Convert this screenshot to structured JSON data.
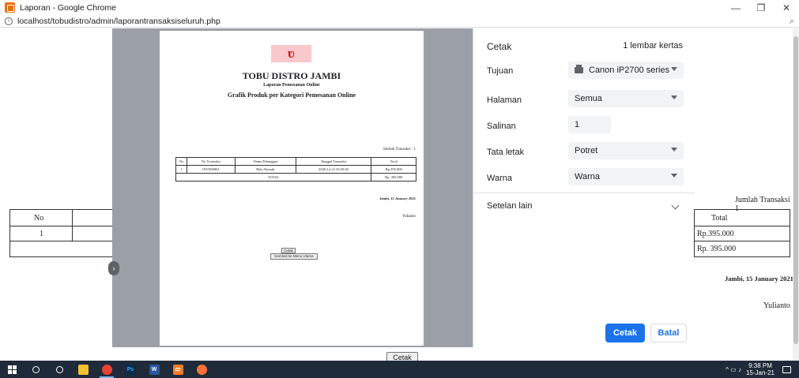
{
  "window": {
    "title": "Laporan - Google Chrome",
    "minimize": "—",
    "maximize": "❐",
    "close": "✕"
  },
  "address": {
    "url": "localhost/tobudistro/admin/laporantransaksiseluruh.php",
    "zoom_icon": "⌕"
  },
  "background_page": {
    "header_no": "No",
    "header_total": "Total",
    "row_no": "1",
    "row_total": "Rp.395.000",
    "footer_total": "Rp. 395.000",
    "jumlah": "Jumlah Transaksi : 1",
    "jambi_date": "Jambi, 15 January 2021",
    "signature": "Yulianto",
    "cetak_button": "Cetak"
  },
  "preview": {
    "logo_glyph": "ʋ",
    "store_name": "TOBU DISTRO JAMBI",
    "report_title": "Laporan Pemesanan Online",
    "chart_title": "Grafik Produk per Kategori Pemesanan Online",
    "jumlah": "Jumlah Transaksi : 1",
    "table_headers": [
      "No",
      "No Transaksi",
      "Nama Pelanggan",
      "Tanggal Transaksi",
      "Total"
    ],
    "table_row": [
      "1",
      "INV000001",
      "Riki Ahmadi",
      "2020-12-21 05:58:02",
      "Rp.395.000"
    ],
    "total_label": "TOTAL",
    "total_value": "Rp. 395.000",
    "jambi_date": "Jambi, 15 January 2021",
    "signature": "Yulianto",
    "btn_cetak": "Cetak",
    "btn_kembali": "Kembali ke Menu Utama"
  },
  "print_settings": {
    "header": "Cetak",
    "sheets": "1 lembar kertas",
    "tujuan_label": "Tujuan",
    "tujuan_value": "Canon iP2700 series",
    "halaman_label": "Halaman",
    "halaman_value": "Semua",
    "salinan_label": "Salinan",
    "salinan_value": "1",
    "tata_letak_label": "Tata letak",
    "tata_letak_value": "Potret",
    "warna_label": "Warna",
    "warna_value": "Warna",
    "setelan_lain": "Setelan lain",
    "cetak_button": "Cetak",
    "batal_button": "Batal"
  },
  "taskbar": {
    "time": "9:38 PM",
    "date": "15-Jan-21",
    "tray_glyphs": "^  ▭  ♪"
  },
  "colors": {
    "accent": "#1a73e8",
    "taskbar": "#1f2b3a",
    "logo": "#d0101c"
  }
}
